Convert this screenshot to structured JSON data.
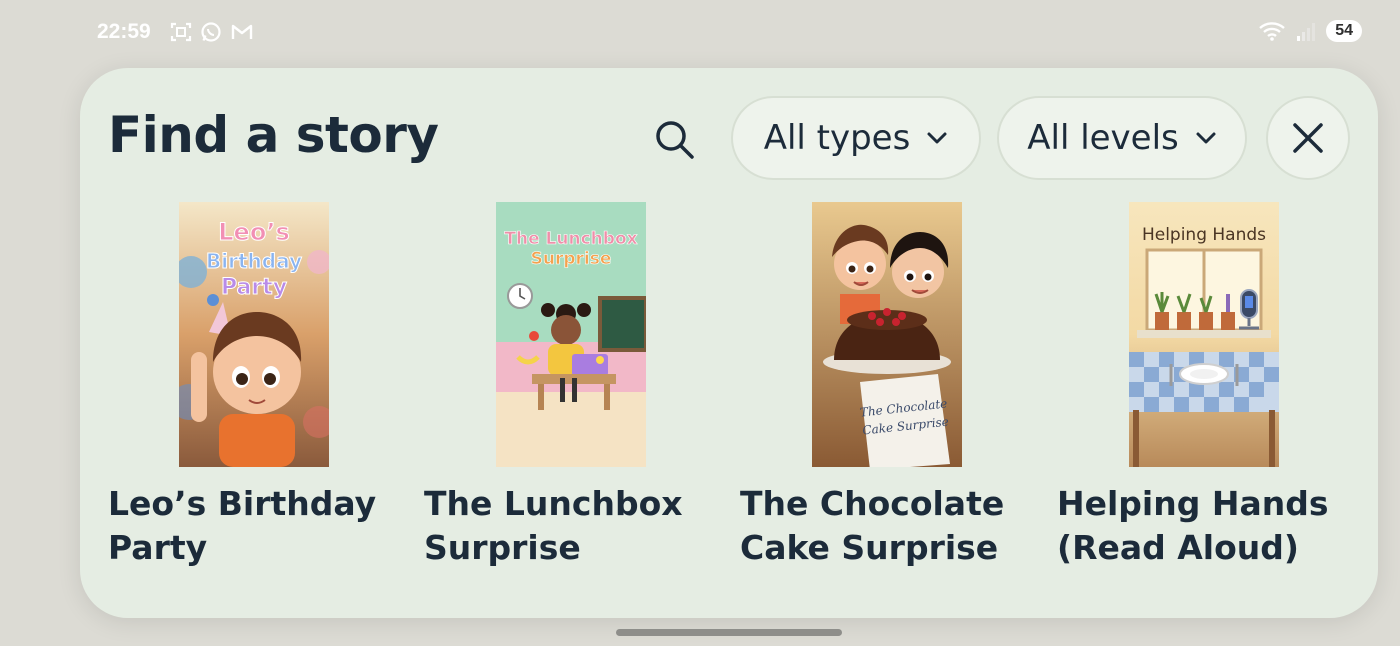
{
  "status_bar": {
    "time": "22:59",
    "battery": "54",
    "left_icons": [
      "screenshot-icon",
      "whatsapp-icon",
      "gmail-icon"
    ],
    "right_icons": [
      "wifi-icon",
      "signal-icon"
    ]
  },
  "dialog": {
    "title": "Find a story",
    "filters": {
      "types_label": "All types",
      "levels_label": "All levels"
    }
  },
  "stories": [
    {
      "title": "Leo’s Birthday Party",
      "cover_text": [
        "Leo’s",
        "Birthday",
        "Party"
      ]
    },
    {
      "title": "The Lunchbox Surprise",
      "cover_text": [
        "The Lunchbox",
        "Surprise"
      ]
    },
    {
      "title": "The Chocolate Cake Surprise",
      "cover_text": [
        "The Chocolate",
        "Cake Surprise"
      ]
    },
    {
      "title": "Helping Hands (Read Aloud)",
      "cover_text": [
        "Helping Hands"
      ]
    }
  ],
  "colors": {
    "card_bg": "#e5ede3",
    "text_dark": "#1c2b3a",
    "pill_bg": "#eef3ec"
  }
}
